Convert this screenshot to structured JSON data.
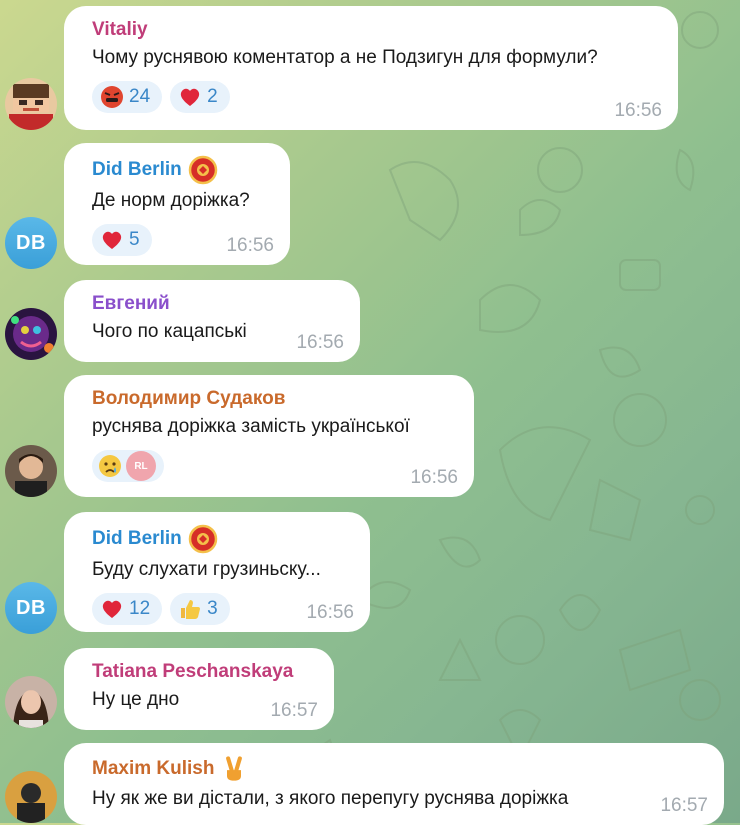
{
  "messages": [
    {
      "sender": "Vitaliy",
      "sender_color": "#c03d79",
      "text": "Чому руснявою коментатор а не Подзигун для формули?",
      "time": "16:56",
      "reactions": [
        {
          "icon": "angry-face-icon",
          "count": "24"
        },
        {
          "icon": "red-heart-icon",
          "count": "2"
        }
      ]
    },
    {
      "sender": "Did Berlin",
      "sender_color": "#2a8ad0",
      "avatar_initials": "DB",
      "text": "Де норм доріжка?",
      "time": "16:56",
      "reactions": [
        {
          "icon": "red-heart-icon",
          "count": "5"
        }
      ]
    },
    {
      "sender": "Евгений",
      "sender_color": "#8a4fcb",
      "text": "Чого по кацапські",
      "time": "16:56"
    },
    {
      "sender": "Володимир Судаков",
      "sender_color": "#c96a2c",
      "text": "руснява доріжка замість української",
      "time": "16:56",
      "reactions": [
        {
          "icon": "crying-face-icon"
        },
        {
          "icon": "reactor-avatar",
          "initials": "RL"
        }
      ]
    },
    {
      "sender": "Did Berlin",
      "sender_color": "#2a8ad0",
      "avatar_initials": "DB",
      "text": "Буду слухати грузиньску...",
      "time": "16:56",
      "reactions": [
        {
          "icon": "red-heart-icon",
          "count": "12"
        },
        {
          "icon": "thumbs-up-icon",
          "count": "3"
        }
      ]
    },
    {
      "sender": "Tatiana Peschanskaya",
      "sender_color": "#c03d79",
      "text": "Ну це дно",
      "time": "16:57"
    },
    {
      "sender": "Maxim Kulish",
      "sender_color": "#c96a2c",
      "text": "Ну як же ви дістали, з якого перепугу руснява доріжка",
      "time": "16:57"
    }
  ]
}
